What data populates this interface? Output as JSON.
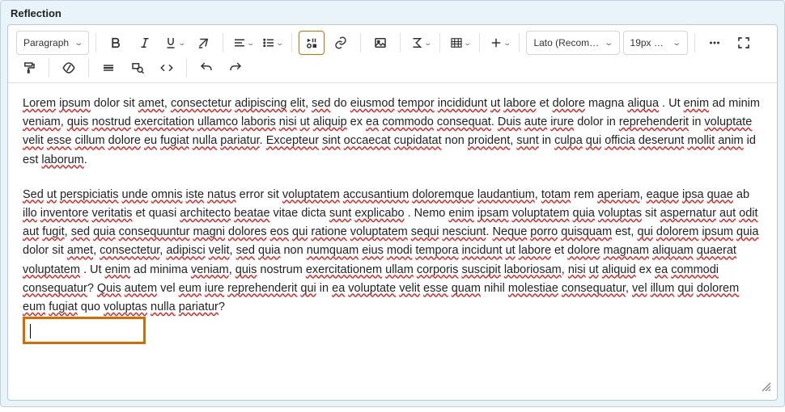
{
  "title": "Reflection",
  "toolbar": {
    "paragraph_label": "Paragraph",
    "font_label": "Lato (Recom…",
    "size_label": "19px …"
  },
  "content": {
    "p1_words": [
      "Lorem",
      "ipsum",
      "dolor sit",
      "amet",
      ",",
      "consectetur",
      "adipiscing",
      "elit",
      ",",
      "sed",
      "do",
      "eiusmod",
      "tempor",
      "incididunt",
      "ut",
      "labore",
      "et",
      "dolore",
      "magna",
      "aliqua",
      ". Ut",
      "enim",
      "ad minim",
      "veniam",
      ",",
      "quis",
      "nostrud",
      "exercitation",
      "ullamco",
      "laboris",
      "nisi",
      "ut",
      "aliquip",
      "ex",
      "ea",
      "commodo",
      "consequat",
      ".",
      "Duis",
      "aute",
      "irure",
      "dolor in",
      "reprehenderit",
      "in",
      "voluptate",
      "velit",
      "esse",
      "cillum",
      "dolore",
      "eu",
      "fugiat",
      "nulla",
      "pariatur",
      ".",
      "Excepteur",
      "sint",
      "occaecat",
      "cupidatat",
      "non",
      "proident",
      ",",
      "sunt",
      "in",
      "culpa",
      "qui",
      "officia",
      "deserunt",
      "mollit",
      "anim",
      "id est",
      "laborum",
      "."
    ],
    "p1_spell": [
      true,
      true,
      false,
      true,
      false,
      true,
      true,
      true,
      false,
      true,
      false,
      true,
      true,
      true,
      true,
      true,
      false,
      true,
      false,
      true,
      false,
      true,
      false,
      true,
      false,
      true,
      true,
      true,
      true,
      true,
      true,
      true,
      true,
      false,
      true,
      true,
      true,
      false,
      true,
      true,
      true,
      false,
      true,
      false,
      true,
      true,
      true,
      true,
      true,
      true,
      true,
      true,
      true,
      false,
      true,
      true,
      true,
      true,
      false,
      true,
      false,
      true,
      false,
      true,
      true,
      true,
      true,
      true,
      true,
      false,
      true,
      false
    ],
    "p2_words": [
      "Sed",
      "ut",
      "perspiciatis",
      "unde",
      "omnis",
      "iste",
      "natus",
      "error sit",
      "voluptatem",
      "accusantium",
      "doloremque",
      "laudantium",
      ",",
      "totam",
      "rem",
      "aperiam",
      ",",
      "eaque",
      "ipsa",
      "quae",
      "ab",
      "illo",
      "inventore",
      "veritatis",
      "et",
      "quasi",
      "architecto",
      "beatae",
      "vitae dicta",
      "sunt",
      "explicabo",
      ". Nemo",
      "enim",
      "ipsam",
      "voluptatem",
      "quia",
      "voluptas",
      "sit",
      "aspernatur",
      "aut",
      "odit",
      "aut",
      "fugit",
      ",",
      "sed",
      "quia",
      "consequuntur",
      "magni",
      "dolores",
      "eos",
      "qui",
      "ratione",
      "voluptatem",
      "sequi",
      "nesciunt",
      ".",
      "Neque",
      "porro",
      "quisquam",
      "est",
      ",",
      "qui",
      "dolorem",
      "ipsum",
      "quia",
      "dolor sit",
      "amet",
      ",",
      "consectetur",
      ",",
      "adipisci",
      "velit",
      ",",
      "sed",
      "quia",
      "non",
      "numquam",
      "eius",
      "modi",
      "tempora",
      "incidunt",
      "ut",
      "labore",
      "et",
      "dolore",
      "magnam",
      "aliquam",
      "quaerat",
      "voluptatem",
      ". Ut",
      "enim",
      "ad minima",
      "veniam",
      ",",
      "quis",
      "nostrum",
      "exercitationem",
      "ullam",
      "corporis",
      "suscipit",
      "laboriosam",
      ",",
      "nisi",
      "ut",
      "aliquid",
      "ex",
      "ea",
      "commodi",
      "consequatur",
      "?",
      "Quis",
      "autem",
      "vel",
      "eum",
      "iure",
      "reprehenderit",
      "qui",
      "in",
      "ea",
      "voluptate",
      "velit",
      "esse",
      "quam",
      "nihil",
      "molestiae",
      "consequatur",
      ",",
      "vel",
      "illum",
      "qui",
      "dolorem",
      "eum",
      "fugiat",
      "quo",
      "voluptas",
      "nulla",
      "pariatur",
      "?"
    ],
    "p2_spell": [
      true,
      true,
      true,
      true,
      true,
      true,
      true,
      false,
      true,
      true,
      true,
      true,
      false,
      true,
      false,
      true,
      false,
      true,
      true,
      true,
      false,
      true,
      true,
      true,
      false,
      false,
      true,
      true,
      false,
      true,
      true,
      false,
      true,
      true,
      true,
      true,
      true,
      false,
      true,
      true,
      true,
      true,
      true,
      false,
      true,
      true,
      true,
      true,
      true,
      true,
      true,
      true,
      true,
      true,
      true,
      false,
      true,
      true,
      true,
      false,
      false,
      true,
      true,
      true,
      true,
      false,
      true,
      false,
      true,
      false,
      true,
      true,
      false,
      true,
      true,
      false,
      true,
      true,
      true,
      true,
      true,
      true,
      true,
      false,
      true,
      true,
      true,
      true,
      true,
      false,
      true,
      false,
      true,
      false,
      true,
      false,
      true,
      true,
      true,
      true,
      true,
      false,
      true,
      true,
      true,
      false,
      true,
      true,
      true,
      false,
      true,
      true,
      false,
      true,
      true,
      true,
      true,
      false,
      true,
      true,
      true,
      true,
      true,
      false,
      true,
      true,
      false,
      true,
      true,
      true,
      true,
      true,
      true,
      false,
      true,
      true,
      true,
      false
    ]
  }
}
